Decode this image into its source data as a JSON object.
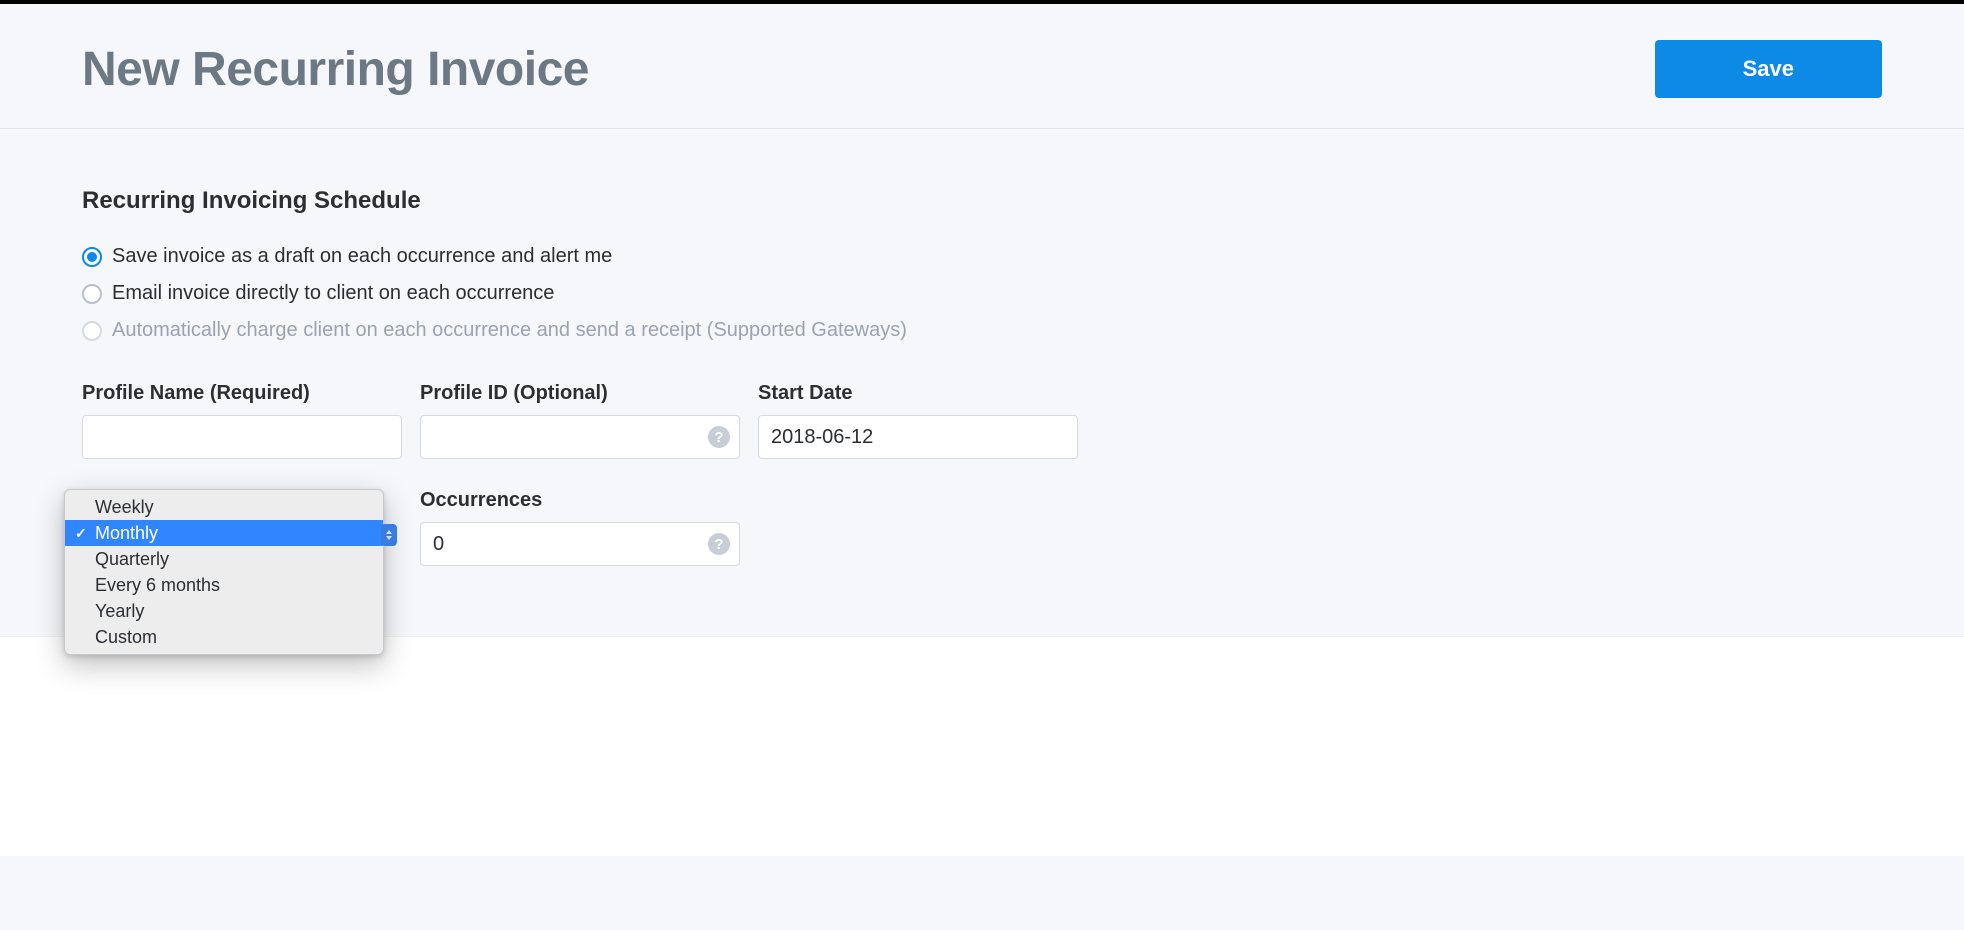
{
  "header": {
    "title": "New Recurring Invoice",
    "save_label": "Save"
  },
  "schedule": {
    "section_title": "Recurring Invoicing Schedule",
    "options": {
      "draft": "Save invoice as a draft on each occurrence and alert me",
      "email": "Email invoice directly to client on each occurrence",
      "charge_prefix": "Automatically charge client on each occurrence and send a receipt ",
      "charge_link": "(Supported Gateways)"
    }
  },
  "fields": {
    "profile_name": {
      "label": "Profile Name (Required)",
      "value": ""
    },
    "profile_id": {
      "label": "Profile ID (Optional)",
      "value": ""
    },
    "start_date": {
      "label": "Start Date",
      "value": "2018-06-12"
    },
    "occurrences": {
      "label": "Occurrences",
      "value": "0"
    }
  },
  "frequency": {
    "selected": "Monthly",
    "options": [
      "Weekly",
      "Monthly",
      "Quarterly",
      "Every 6 months",
      "Yearly",
      "Custom"
    ]
  }
}
